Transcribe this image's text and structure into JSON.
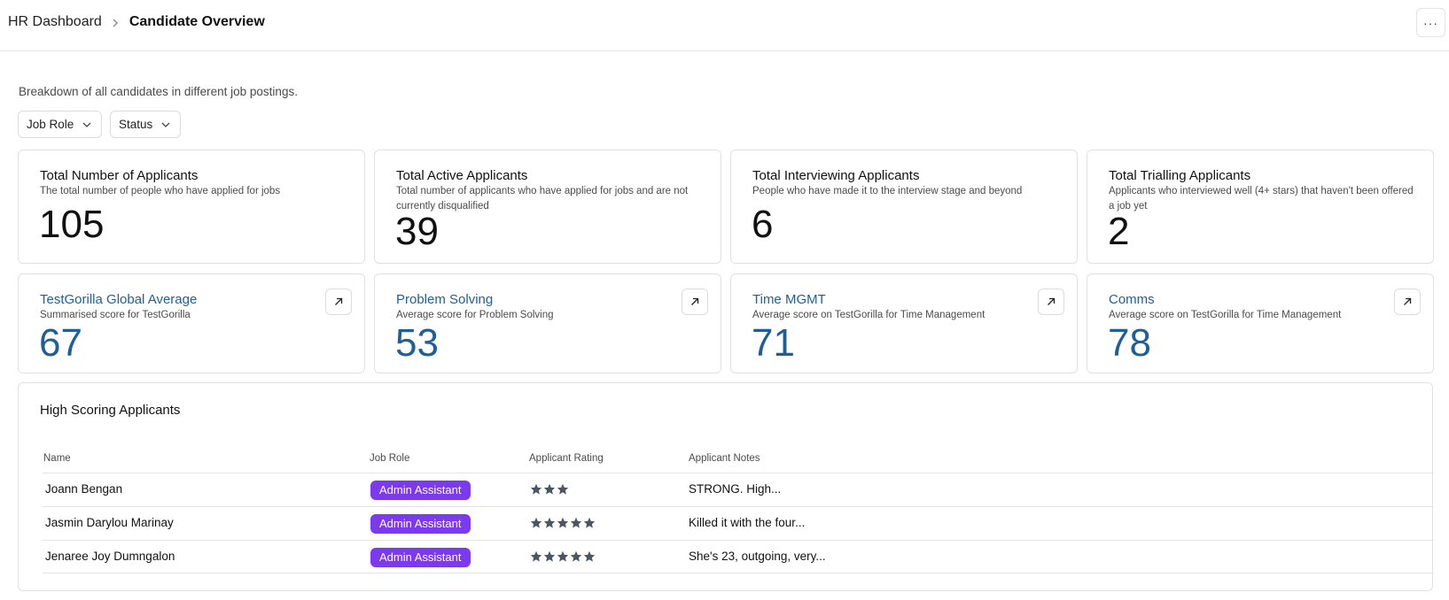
{
  "breadcrumb": {
    "root": "HR Dashboard",
    "current": "Candidate Overview"
  },
  "more_menu": "···",
  "subtitle": "Breakdown of all candidates in different job postings.",
  "filters": [
    {
      "label": "Job Role"
    },
    {
      "label": "Status"
    }
  ],
  "summary_cards": [
    {
      "title": "Total Number of Applicants",
      "description": "The total number of people who have applied for jobs",
      "value": "105"
    },
    {
      "title": "Total Active Applicants",
      "description": "Total number of applicants who have applied for jobs and are not currently disqualified",
      "value": "39"
    },
    {
      "title": "Total Interviewing Applicants",
      "description": "People who have made it to the interview stage and beyond",
      "value": "6"
    },
    {
      "title": "Total Trialling Applicants",
      "description": "Applicants who interviewed well (4+ stars) that haven't been offered a job yet",
      "value": "2"
    }
  ],
  "metric_cards": [
    {
      "title": "TestGorilla Global Average",
      "description": "Summarised score for TestGorilla",
      "value": "67"
    },
    {
      "title": "Problem Solving",
      "description": "Average score for Problem Solving",
      "value": "53"
    },
    {
      "title": "Time MGMT",
      "description": "Average score on TestGorilla for Time Management",
      "value": "71"
    },
    {
      "title": "Comms",
      "description": "Average score on TestGorilla for Time Management",
      "value": "78"
    }
  ],
  "high_scoring": {
    "title": "High Scoring Applicants",
    "columns": [
      "Name",
      "Job Role",
      "Applicant Rating",
      "Applicant Notes"
    ],
    "rows": [
      {
        "name": "Joann Bengan",
        "role": "Admin Assistant",
        "rating": 3,
        "notes": "STRONG. High..."
      },
      {
        "name": "Jasmin Darylou Marinay",
        "role": "Admin Assistant",
        "rating": 5,
        "notes": "Killed it with the four..."
      },
      {
        "name": "Jenaree Joy Dumngalon",
        "role": "Admin Assistant",
        "rating": 5,
        "notes": "She's 23, outgoing, very..."
      }
    ]
  },
  "colors": {
    "accent": "#1f5f99",
    "badge": "#7c3aed",
    "star": "#4b5563",
    "border": "#e1e1e4"
  }
}
